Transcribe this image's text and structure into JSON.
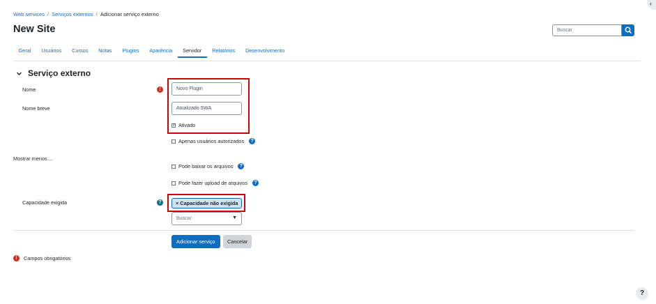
{
  "breadcrumb": [
    "Web services",
    "Serviços externos",
    "Adicionar serviço externo"
  ],
  "page_title": "New Site",
  "search": {
    "placeholder": "Buscar"
  },
  "tabs": [
    {
      "label": "Geral",
      "active": false
    },
    {
      "label": "Usuários",
      "active": false
    },
    {
      "label": "Cursos",
      "active": false
    },
    {
      "label": "Notas",
      "active": false
    },
    {
      "label": "Plugins",
      "active": false
    },
    {
      "label": "Aparência",
      "active": false
    },
    {
      "label": "Servidor",
      "active": true
    },
    {
      "label": "Relatórios",
      "active": false
    },
    {
      "label": "Desenvolvimento",
      "active": false
    }
  ],
  "section": {
    "title": "Serviço externo"
  },
  "form": {
    "name_label": "Nome",
    "name_value": "Novo Plugin",
    "shortname_label": "Nome breve",
    "shortname_value": "Atualizado SWA",
    "enabled_label": "Ativado",
    "enabled_checked": true,
    "authorised_label": "Apenas usuários autorizados",
    "show_less": "Mostrar menos ...",
    "download_label": "Pode baixar os arquivos",
    "upload_label": "Pode fazer upload de arquivos",
    "capability_label": "Capacidade exigida",
    "capability_tag": "Capacidade não exigida",
    "capability_search_placeholder": "Buscar",
    "submit_label": "Adicionar serviço",
    "cancel_label": "Cancelar",
    "required_note": "Campos obrigatórios"
  },
  "colors": {
    "accent": "#0f6cbf",
    "highlight": "#d40000",
    "required": "#ca3120"
  }
}
